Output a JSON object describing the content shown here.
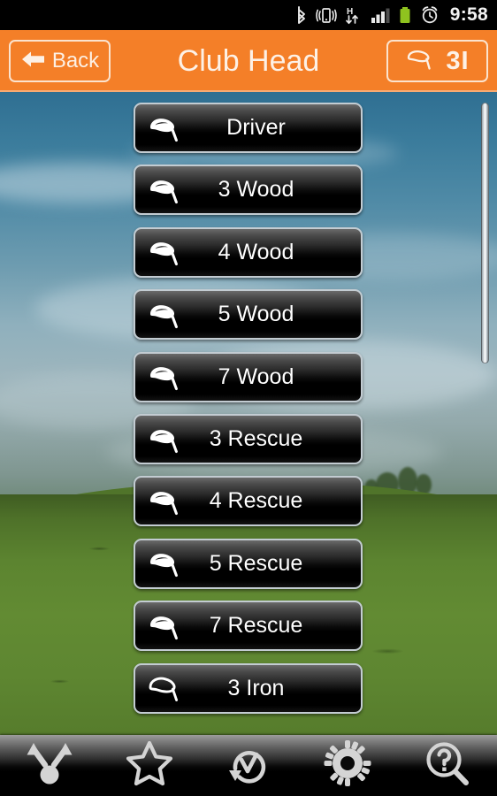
{
  "statusbar": {
    "time": "9:58",
    "icons": [
      {
        "name": "bluetooth-icon"
      },
      {
        "name": "vibrate-icon"
      },
      {
        "name": "hspa-data-icon",
        "label": "H"
      },
      {
        "name": "signal-bars-icon"
      },
      {
        "name": "battery-icon"
      },
      {
        "name": "alarm-clock-icon"
      }
    ]
  },
  "header": {
    "back_label": "Back",
    "title": "Club Head",
    "badge_label": "3I",
    "accent_color": "#f47f28",
    "text_color": "#fdf1e6"
  },
  "list": {
    "items": [
      {
        "label": "Driver",
        "icon": "club-head-wood-icon"
      },
      {
        "label": "3 Wood",
        "icon": "club-head-wood-icon"
      },
      {
        "label": "4 Wood",
        "icon": "club-head-wood-icon"
      },
      {
        "label": "5 Wood",
        "icon": "club-head-wood-icon"
      },
      {
        "label": "7 Wood",
        "icon": "club-head-wood-icon"
      },
      {
        "label": "3 Rescue",
        "icon": "club-head-wood-icon"
      },
      {
        "label": "4 Rescue",
        "icon": "club-head-wood-icon"
      },
      {
        "label": "5 Rescue",
        "icon": "club-head-wood-icon"
      },
      {
        "label": "7 Rescue",
        "icon": "club-head-wood-icon"
      },
      {
        "label": "3 Iron",
        "icon": "club-head-iron-icon"
      }
    ]
  },
  "toolbar": {
    "items": [
      {
        "name": "shot-dispersion-icon"
      },
      {
        "name": "star-favorite-icon"
      },
      {
        "name": "sync-check-icon"
      },
      {
        "name": "gear-settings-icon"
      },
      {
        "name": "help-search-icon"
      }
    ]
  }
}
